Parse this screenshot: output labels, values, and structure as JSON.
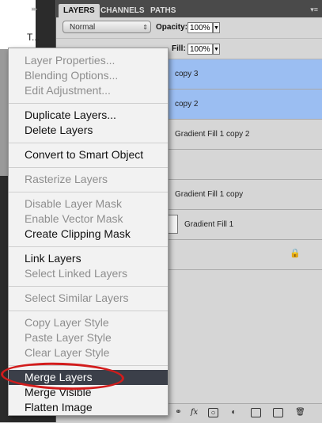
{
  "background": {
    "left_text_fragment": "T..."
  },
  "panel": {
    "tabs": [
      {
        "label": "LAYERS"
      },
      {
        "label": "CHANNELS"
      },
      {
        "label": "PATHS"
      }
    ],
    "blend_mode": "Normal",
    "opacity_label": "Opacity:",
    "opacity_value": "100%",
    "fill_label": "Fill:",
    "fill_value": "100%",
    "layers": [
      {
        "name": "copy 3",
        "selected": true
      },
      {
        "name": "copy 2",
        "selected": true
      },
      {
        "name": "Gradient Fill 1 copy 2",
        "selected": false
      },
      {
        "name": "",
        "selected": false
      },
      {
        "name": "Gradient Fill 1 copy",
        "selected": false
      },
      {
        "name": "Gradient Fill 1",
        "selected": false
      },
      {
        "name": "",
        "selected": false
      },
      {
        "name": "",
        "selected": false
      }
    ],
    "bottom_icons": [
      "link-icon",
      "fx-icon",
      "mask-icon",
      "adjustment-icon",
      "folder-icon",
      "new-layer-icon",
      "trash-icon"
    ],
    "fx_label": "fx"
  },
  "menu": {
    "items": [
      {
        "label": "Layer Properties...",
        "enabled": false
      },
      {
        "label": "Blending Options...",
        "enabled": false
      },
      {
        "label": "Edit Adjustment...",
        "enabled": false
      },
      {
        "label": "Duplicate Layers...",
        "enabled": true
      },
      {
        "label": "Delete Layers",
        "enabled": true
      },
      {
        "label": "Convert to Smart Object",
        "enabled": true
      },
      {
        "label": "Rasterize Layers",
        "enabled": false
      },
      {
        "label": "Disable Layer Mask",
        "enabled": false
      },
      {
        "label": "Enable Vector Mask",
        "enabled": false
      },
      {
        "label": "Create Clipping Mask",
        "enabled": true
      },
      {
        "label": "Link Layers",
        "enabled": true
      },
      {
        "label": "Select Linked Layers",
        "enabled": false
      },
      {
        "label": "Select Similar Layers",
        "enabled": false
      },
      {
        "label": "Copy Layer Style",
        "enabled": false
      },
      {
        "label": "Paste Layer Style",
        "enabled": false
      },
      {
        "label": "Clear Layer Style",
        "enabled": false
      },
      {
        "label": "Merge Layers",
        "enabled": true,
        "highlighted": true
      },
      {
        "label": "Merge Visible",
        "enabled": true
      },
      {
        "label": "Flatten Image",
        "enabled": true
      }
    ]
  },
  "colors": {
    "selection_blue": "#9bbef2",
    "menu_highlight": "#3b3f49",
    "annotation_red": "#d21c1c"
  }
}
